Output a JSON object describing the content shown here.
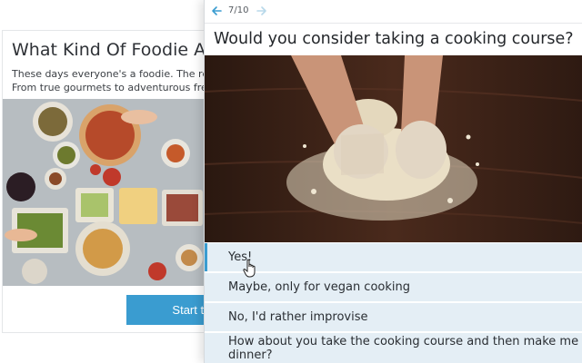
{
  "intro_card": {
    "title": "What Kind Of Foodie Are Y",
    "description_lines": [
      "These days everyone's a foodie. The real que",
      "From true gourmets to adventurous free spi"
    ],
    "start_button_label": "Start the"
  },
  "question_card": {
    "counter": "7/10",
    "question": "Would you consider taking a cooking course?",
    "answers": [
      {
        "label": "Yes!",
        "selected": true
      },
      {
        "label": "Maybe, only for vegan cooking",
        "selected": false
      },
      {
        "label": "No, I'd rather improvise",
        "selected": false
      },
      {
        "label": "How about you take the cooking course and then make me dinner?",
        "selected": false
      }
    ]
  },
  "icons": {
    "back": "arrow-left-icon",
    "forward": "arrow-right-icon",
    "cursor": "hand-pointer-icon"
  },
  "colors": {
    "accent": "#3a9cd0",
    "answer_bg": "#e4eef5",
    "nav_arrow_active": "#3a9cd0",
    "nav_arrow_inactive": "#b8d8ea"
  }
}
